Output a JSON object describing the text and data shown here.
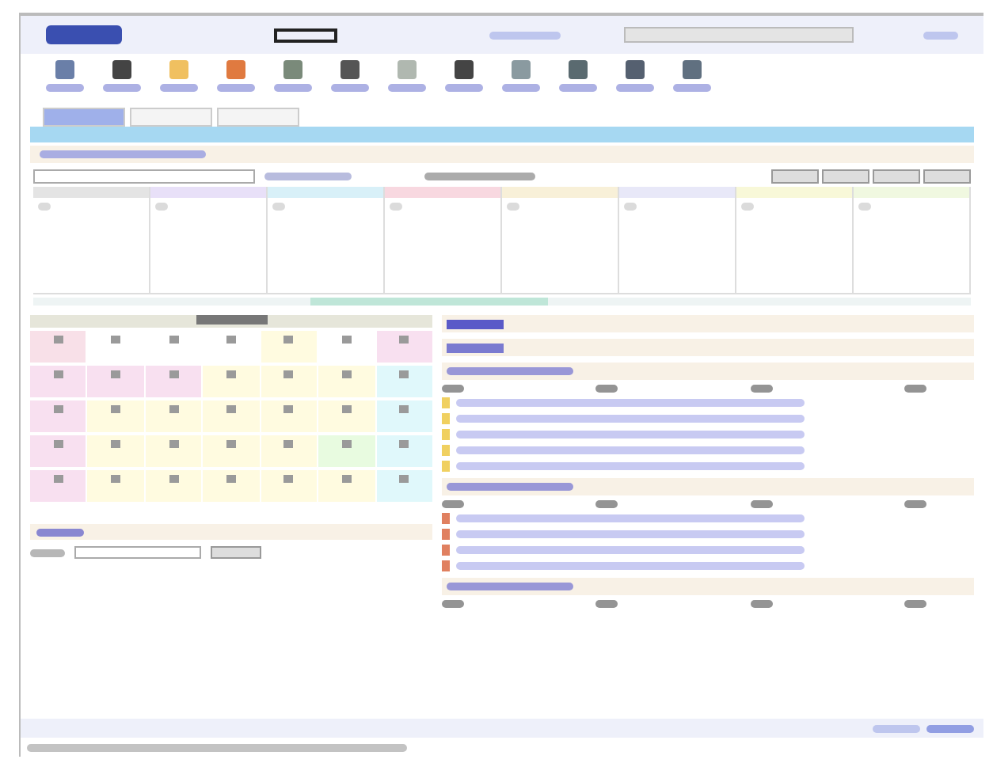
{
  "toolbar": [
    {
      "color": "#6a7fa8"
    },
    {
      "color": "#444444"
    },
    {
      "color": "#f0c060"
    },
    {
      "color": "#e07a40"
    },
    {
      "color": "#7a8a7a"
    },
    {
      "color": "#555555"
    },
    {
      "color": "#b0b8b0"
    },
    {
      "color": "#444444"
    },
    {
      "color": "#8a9aa0"
    },
    {
      "color": "#5a6a70"
    },
    {
      "color": "#556070"
    },
    {
      "color": "#607080"
    }
  ],
  "tabs": [
    {
      "selected": true
    },
    {
      "selected": false
    },
    {
      "selected": false
    }
  ],
  "week_columns": [
    {
      "color": "#e4e4e4"
    },
    {
      "color": "#e8e0f8"
    },
    {
      "color": "#d8f0f8"
    },
    {
      "color": "#f8d8e0"
    },
    {
      "color": "#f8f0d8"
    },
    {
      "color": "#e8e8f8"
    },
    {
      "color": "#f8f8d8"
    },
    {
      "color": "#f0f8e0"
    }
  ],
  "calendar_weeks": [
    {
      "days": [
        {
          "color": "#f8e0e8"
        },
        {
          "color": "#ffffff"
        },
        {
          "color": "#ffffff"
        },
        {
          "color": "#ffffff"
        },
        {
          "color": "#fffbe0"
        },
        {
          "color": "#ffffff"
        },
        {
          "color": "#f8e0f0"
        }
      ]
    },
    {
      "days": [
        {
          "color": "#f8e0f0"
        },
        {
          "color": "#f8e0f0"
        },
        {
          "color": "#f8e0f0"
        },
        {
          "color": "#fffbe0"
        },
        {
          "color": "#fffbe0"
        },
        {
          "color": "#fffbe0"
        },
        {
          "color": "#e0f8fb"
        }
      ]
    },
    {
      "days": [
        {
          "color": "#f8e0f0"
        },
        {
          "color": "#fffbe0"
        },
        {
          "color": "#fffbe0"
        },
        {
          "color": "#fffbe0"
        },
        {
          "color": "#fffbe0"
        },
        {
          "color": "#fffbe0"
        },
        {
          "color": "#e0f8fb"
        }
      ]
    },
    {
      "days": [
        {
          "color": "#f8e0f0"
        },
        {
          "color": "#fffbe0"
        },
        {
          "color": "#fffbe0"
        },
        {
          "color": "#fffbe0"
        },
        {
          "color": "#fffbe0"
        },
        {
          "color": "#e8fbe0"
        },
        {
          "color": "#e0f8fb"
        }
      ]
    },
    {
      "days": [
        {
          "color": "#f8e0f0"
        },
        {
          "color": "#fffbe0"
        },
        {
          "color": "#fffbe0"
        },
        {
          "color": "#fffbe0"
        },
        {
          "color": "#fffbe0"
        },
        {
          "color": "#fffbe0"
        },
        {
          "color": "#e0f8fb"
        }
      ]
    }
  ],
  "portlets": [
    {
      "kind": "note",
      "lines": [
        {
          "color": "#5a5ac8"
        }
      ]
    },
    {
      "kind": "note",
      "lines": [
        {
          "color": "#7a7ad0"
        }
      ]
    },
    {
      "kind": "table",
      "lines": [
        {
          "color": "#f0d060"
        },
        {
          "color": "#f0d060"
        },
        {
          "color": "#f0d060"
        },
        {
          "color": "#f0d060"
        },
        {
          "color": "#f0d060"
        }
      ]
    },
    {
      "kind": "table",
      "lines": [
        {
          "color": "#e08060"
        },
        {
          "color": "#e08060"
        },
        {
          "color": "#e08060"
        },
        {
          "color": "#e08060"
        }
      ]
    },
    {
      "kind": "header"
    }
  ]
}
